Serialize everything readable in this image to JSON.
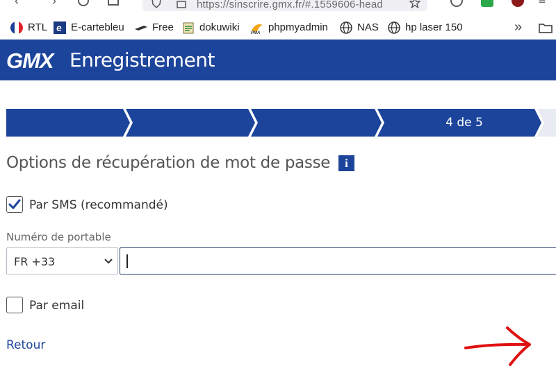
{
  "browser": {
    "url": "https://sinscrire.gmx.fr/#.1559606-head",
    "bookmarks": [
      {
        "label": "RTL",
        "icon": "flag-fr-icon"
      },
      {
        "label": "E-cartebleu",
        "icon": "e-cartebleu-icon"
      },
      {
        "label": "Free",
        "icon": "router-icon"
      },
      {
        "label": "dokuwiki",
        "icon": "dokuwiki-icon"
      },
      {
        "label": "phpmyadmin",
        "icon": "phpmyadmin-icon"
      },
      {
        "label": "NAS",
        "icon": "globe-icon"
      },
      {
        "label": "hp laser 150",
        "icon": "globe-icon"
      }
    ],
    "overflow_label": "»"
  },
  "header": {
    "logo": "GMX",
    "title": "Enregistrement"
  },
  "progress": {
    "current_label": "4 de 5",
    "current_step": 4,
    "total_steps": 5
  },
  "section": {
    "title": "Options de récupération de mot de passe",
    "info_glyph": "i"
  },
  "sms_option": {
    "label": "Par SMS (recommandé)",
    "checked": true
  },
  "phone": {
    "field_label": "Numéro de portable",
    "country_code": "FR +33",
    "value": "",
    "placeholder": ""
  },
  "email_option": {
    "label": "Par email",
    "checked": false
  },
  "footer": {
    "back_label": "Retour"
  },
  "colors": {
    "brand_blue": "#1c449b",
    "annotation_red": "#e01010"
  }
}
